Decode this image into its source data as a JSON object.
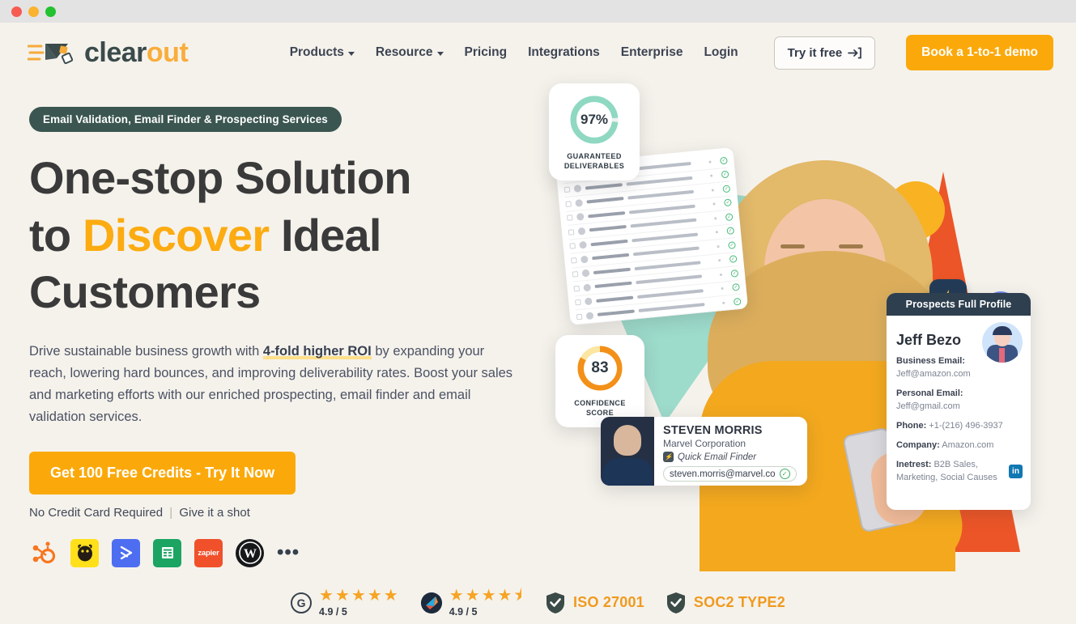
{
  "window": {
    "traffic_lights": [
      "close",
      "minimize",
      "maximize"
    ]
  },
  "header": {
    "logo": {
      "text_primary": "clear",
      "text_accent": "out",
      "icon": "envelope-logo-icon"
    },
    "nav": [
      {
        "label": "Products",
        "has_dropdown": true
      },
      {
        "label": "Resource",
        "has_dropdown": true
      },
      {
        "label": "Pricing",
        "has_dropdown": false
      },
      {
        "label": "Integrations",
        "has_dropdown": false
      },
      {
        "label": "Enterprise",
        "has_dropdown": false
      },
      {
        "label": "Login",
        "has_dropdown": false
      }
    ],
    "try_free_label": "Try it free",
    "try_free_icon": "arrow-right-into-bracket-icon",
    "demo_label": "Book a 1-to-1 demo"
  },
  "hero": {
    "badge": "Email Validation, Email Finder & Prospecting Services",
    "heading_line1": "One-stop Solution",
    "heading_line2_pre": "to ",
    "heading_line2_highlight": "Discover",
    "heading_line2_post": " Ideal",
    "heading_line3": "Customers",
    "paragraph_pre": "Drive sustainable business growth with ",
    "paragraph_highlight": "4-fold higher ROI",
    "paragraph_post": " by expanding your reach, lowering hard bounces, and improving deliverability rates. Boost your sales and marketing efforts with our enriched prospecting, email finder and email validation services.",
    "cta_label": "Get 100 Free Credits - Try It Now",
    "cta_sub_left": "No Credit Card Required",
    "cta_sub_sep": "|",
    "cta_sub_right": "Give it a shot",
    "integrations": [
      {
        "name": "hubspot-logo",
        "label": ""
      },
      {
        "name": "mailchimp-logo",
        "label": ""
      },
      {
        "name": "activecampaign-logo",
        "label": ""
      },
      {
        "name": "google-sheets-logo",
        "label": ""
      },
      {
        "name": "zapier-logo",
        "label": "zapier"
      },
      {
        "name": "wordpress-logo",
        "label": ""
      }
    ],
    "integrations_more": "•••"
  },
  "art": {
    "deliverables_card": {
      "value": "97%",
      "caption_line1": "GUARANTEED",
      "caption_line2": "DELIVERABLES",
      "ring_color": "#8fd8c1",
      "percent": 97
    },
    "confidence_card": {
      "value": "83",
      "caption_line1": "CONFIDENCE",
      "caption_line2": "SCORE",
      "ring_color": "#f39019",
      "track_color": "#fbe6a2",
      "percent": 83
    },
    "steven_card": {
      "name": "STEVEN MORRIS",
      "company": "Marvel Corporation",
      "tool_label": "Quick Email Finder",
      "email": "steven.morris@marvel.co",
      "verified_icon": "green-check-icon"
    },
    "profile_card": {
      "title": "Prospects Full Profile",
      "name": "Jeff Bezo",
      "rows": [
        {
          "label": "Business Email:",
          "value": "Jeff@amazon.com",
          "stacked": true
        },
        {
          "label": "Personal Email:",
          "value": "Jeff@gmail.com",
          "stacked": true
        },
        {
          "label": "Phone:",
          "value": " +1-(216) 496-3937",
          "stacked": false
        },
        {
          "label": "Company:",
          "value": " Amazon.com",
          "stacked": false
        },
        {
          "label": "Inetrest:",
          "value": " B2B Sales, Marketing, Social Causes",
          "stacked": false
        }
      ],
      "linkedin_label": "in"
    },
    "bolt_chip_icon": "lightning-bolt-icon",
    "shapes": {
      "circle_yellow": "#f9b222",
      "circle_blue": "#6f86e8",
      "circle_orange": "#ec5527",
      "triangle_mint": "#9ddbcb",
      "triangle_orange": "#ec5527"
    }
  },
  "trust": {
    "items": [
      {
        "icon": "g2-icon",
        "stars": "★★★★★",
        "rating": "4.9 / 5",
        "type": "rating"
      },
      {
        "icon": "capterra-icon",
        "stars": "★★★★⯨",
        "rating": "4.9 / 5",
        "type": "rating"
      },
      {
        "icon": "shield-check-icon",
        "label": "ISO 27001",
        "type": "cert"
      },
      {
        "icon": "shield-check-icon",
        "label": "SOC2 TYPE2",
        "type": "cert"
      }
    ]
  },
  "colors": {
    "accent_orange": "#fba90a",
    "brand_dark": "#3b4b4b",
    "page_bg": "#f5f2ec",
    "badge_bg": "#3b5650"
  }
}
